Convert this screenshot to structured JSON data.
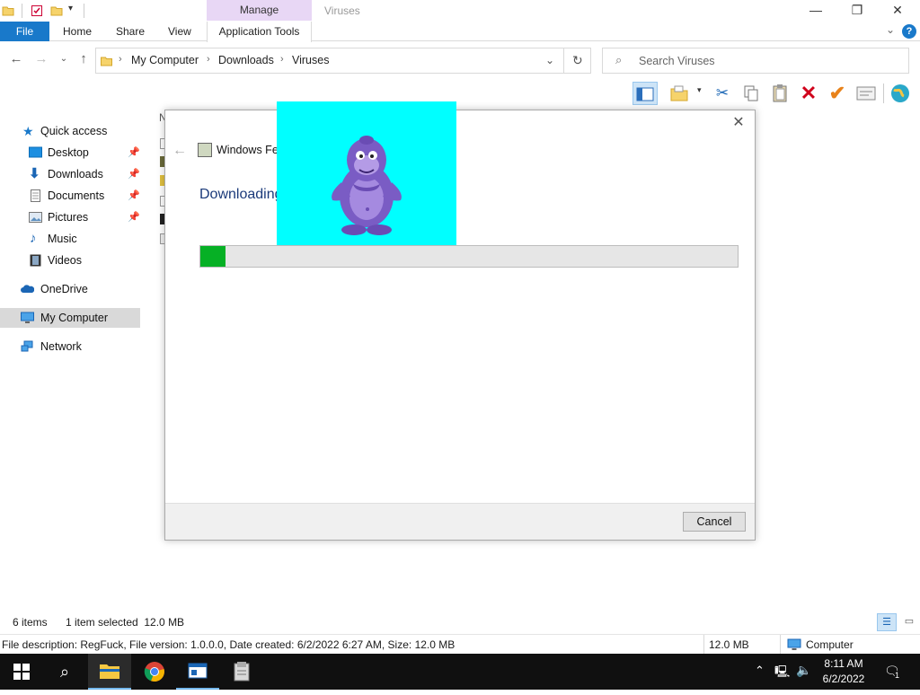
{
  "titlebar": {
    "manage_label": "Manage",
    "window_title": "Viruses",
    "minimize": "—",
    "maximize": "❐",
    "close": "✕"
  },
  "ribbon": {
    "file": "File",
    "home": "Home",
    "share": "Share",
    "view": "View",
    "application_tools": "Application Tools",
    "expand": "⌄",
    "help": "?"
  },
  "address": {
    "crumbs": [
      "My Computer",
      "Downloads",
      "Viruses"
    ],
    "search_placeholder": "Search Viruses"
  },
  "nav": {
    "quick_access": "Quick access",
    "desktop": "Desktop",
    "downloads": "Downloads",
    "documents": "Documents",
    "pictures": "Pictures",
    "music": "Music",
    "videos": "Videos",
    "onedrive": "OneDrive",
    "my_computer": "My Computer",
    "network": "Network"
  },
  "list_header_initial": "N",
  "dialog": {
    "title": "Windows Fea",
    "heading": "Downloading",
    "progress_fraction": 0.047,
    "cancel": "Cancel"
  },
  "status": {
    "items": "6 items",
    "selected": "1 item selected  12.0 MB",
    "description": "File description: RegFuck, File version: 1.0.0.0, Date created: 6/2/2022 6:27 AM, Size: 12.0 MB",
    "size": "12.0 MB",
    "location": "Computer"
  },
  "taskbar": {
    "time": "8:11 AM",
    "date": "6/2/2022",
    "notifications": "1"
  },
  "colors": {
    "accent": "#1979ca",
    "manage_tab": "#e8d7f5",
    "progress": "#06b025",
    "bonzi_bg": "#00ffff",
    "taskbar": "#101010"
  }
}
